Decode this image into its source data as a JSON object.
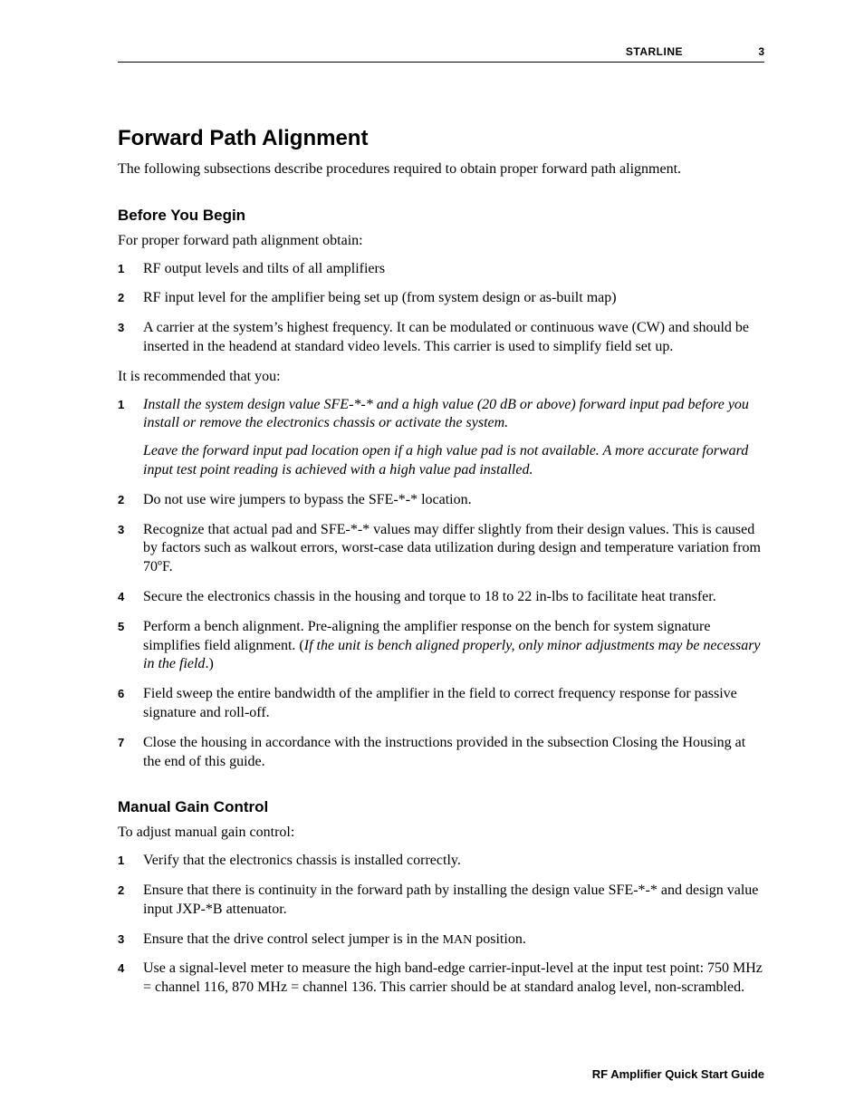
{
  "header": {
    "brand": "STARLINE",
    "page_number": "3"
  },
  "section": {
    "title": "Forward Path Alignment",
    "intro": "The following subsections describe procedures required to obtain proper forward path alignment."
  },
  "before": {
    "title": "Before You Begin",
    "intro": "For proper forward path alignment obtain:",
    "obtain": [
      "RF output levels and tilts of all amplifiers",
      "RF input level for the amplifier being set up (from system design or as-built map)",
      "A carrier at the system’s highest frequency. It can be modulated or continuous wave (CW) and should be inserted in the headend at standard video levels. This carrier is used to simplify field set up."
    ],
    "recommend_intro": "It is recommended that you:",
    "recommend": [
      {
        "paras": [
          {
            "text": "Install the system design value SFE-*-* and a high value (20 dB or above) forward input pad before you install or remove the electronics chassis or activate the system.",
            "italic": true
          },
          {
            "text": "Leave the forward input pad location open if a high value pad is not available. A more accurate forward input test point reading is achieved with a high value pad installed.",
            "italic": true
          }
        ]
      },
      {
        "paras": [
          {
            "text": "Do not use wire jumpers to bypass the SFE-*-* location.",
            "italic": false
          }
        ]
      },
      {
        "paras": [
          {
            "text": "Recognize that actual pad and SFE-*-* values may differ slightly from their design values. This is caused by factors such as walkout errors, worst-case data utilization during design and temperature variation from 70ºF.",
            "italic": false
          }
        ]
      },
      {
        "paras": [
          {
            "text": "Secure the electronics chassis in the housing and torque to 18 to 22 in-lbs to facilitate heat transfer.",
            "italic": false
          }
        ]
      },
      {
        "paras": [
          {
            "pre": "Perform a bench alignment. Pre-aligning the amplifier response on the bench for system signature simplifies field alignment. (",
            "mid_italic": "If the unit is bench aligned properly, only minor adjustments may be necessary in the field",
            "post": ".)"
          }
        ]
      },
      {
        "paras": [
          {
            "text": "Field sweep the entire bandwidth of the amplifier in the field to correct frequency response for passive signature and roll-off.",
            "italic": false
          }
        ]
      },
      {
        "paras": [
          {
            "text": "Close the housing in accordance with the instructions provided in the subsection Closing the Housing at the end of this guide.",
            "italic": false
          }
        ]
      }
    ]
  },
  "manual": {
    "title": "Manual Gain Control",
    "intro": "To adjust manual gain control:",
    "steps": [
      {
        "text": "Verify that the electronics chassis is installed correctly."
      },
      {
        "text": "Ensure that there is continuity in the forward path by installing the design value SFE-*-* and design value input JXP-*B attenuator."
      },
      {
        "pre": "Ensure that the drive control select jumper is in the ",
        "sc": "MAN",
        "post": " position."
      },
      {
        "text": "Use a signal-level meter to measure the high band-edge carrier-input-level at the input test point: 750 MHz = channel 116, 870 MHz = channel 136. This carrier should be at standard analog level, non-scrambled."
      }
    ]
  },
  "footer": {
    "text": "RF Amplifier Quick Start Guide"
  }
}
